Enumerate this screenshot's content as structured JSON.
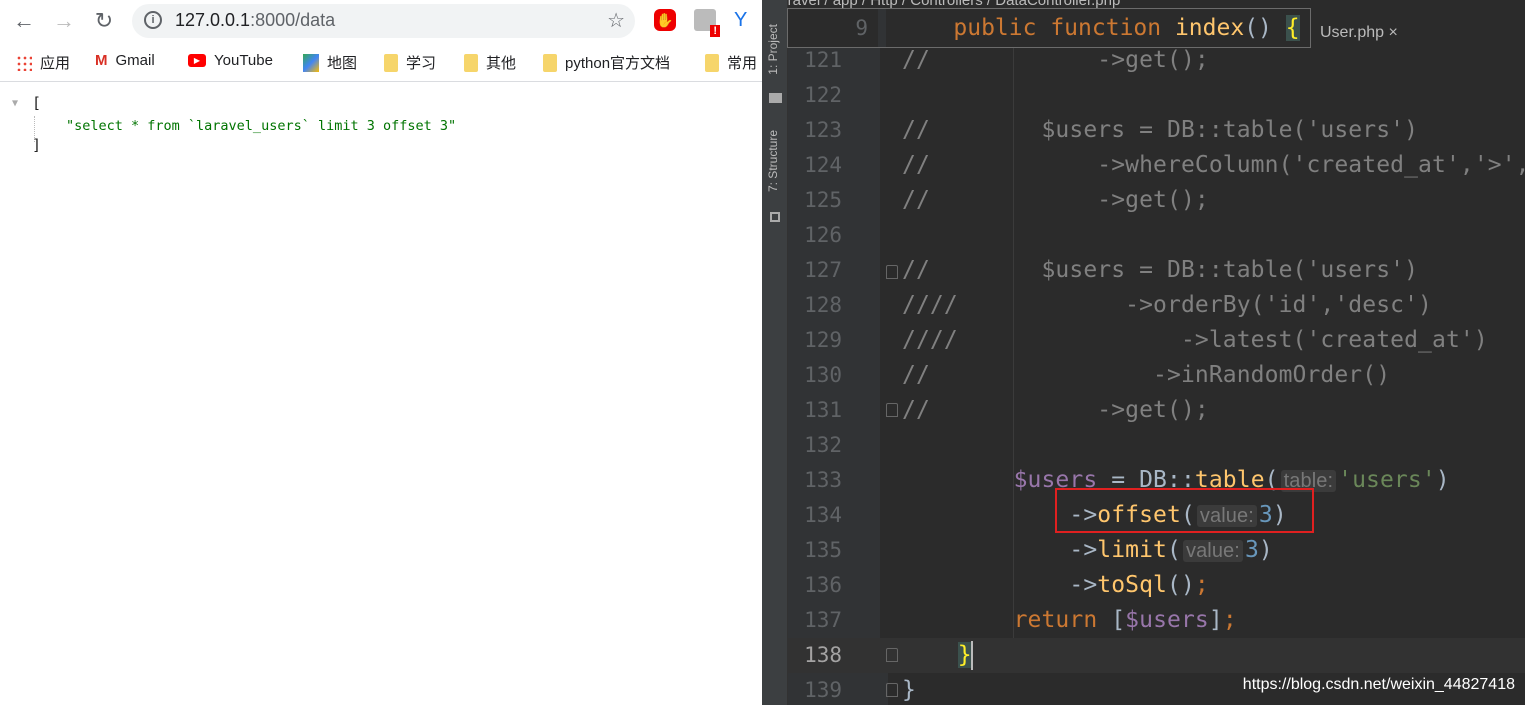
{
  "browser": {
    "url_host": "127.0.0.1",
    "url_rest": ":8000/data",
    "bookmarks": [
      {
        "label": "应用",
        "icon": "apps-grid-icon"
      },
      {
        "label": "Gmail",
        "icon": "gmail-icon"
      },
      {
        "label": "YouTube",
        "icon": "youtube-icon"
      },
      {
        "label": "地图",
        "icon": "maps-icon"
      },
      {
        "label": "学习",
        "icon": "folder-icon"
      },
      {
        "label": "其他",
        "icon": "folder-icon"
      },
      {
        "label": "python官方文档",
        "icon": "folder-icon"
      },
      {
        "label": "常用",
        "icon": "folder-icon"
      }
    ],
    "json_open": "[",
    "json_value": "\"select * from `laravel_users` limit 3 offset 3\"",
    "json_close": "]"
  },
  "ide": {
    "breadcrumb": "laravel / app / Http / Controllers / DataController.php",
    "tab_partial": "User.php ×",
    "tool_windows": [
      "1: Project",
      "7: Structure"
    ],
    "popup": {
      "line": "9",
      "tokens": [
        {
          "t": "    public ",
          "c": "kw"
        },
        {
          "t": "function ",
          "c": "kw"
        },
        {
          "t": "index",
          "c": "fn"
        },
        {
          "t": "() ",
          "c": "p"
        },
        {
          "t": "{",
          "c": "br"
        }
      ]
    },
    "current_line": "138",
    "lines": [
      {
        "n": "121",
        "tokens": [
          {
            "t": "//            ->get();",
            "c": "cm"
          }
        ]
      },
      {
        "n": "122",
        "tokens": []
      },
      {
        "n": "123",
        "tokens": [
          {
            "t": "//        $users = DB::table('users')",
            "c": "cm"
          }
        ]
      },
      {
        "n": "124",
        "tokens": [
          {
            "t": "//            ->whereColumn('created_at','>',",
            "c": "cm"
          }
        ]
      },
      {
        "n": "125",
        "tokens": [
          {
            "t": "//            ->get();",
            "c": "cm"
          }
        ]
      },
      {
        "n": "126",
        "tokens": []
      },
      {
        "n": "127",
        "tokens": [
          {
            "t": "//        $users = DB::table('users')",
            "c": "cm"
          }
        ]
      },
      {
        "n": "128",
        "tokens": [
          {
            "t": "////            ->orderBy('id','desc')",
            "c": "cm"
          }
        ]
      },
      {
        "n": "129",
        "tokens": [
          {
            "t": "////                ->latest('created_at')",
            "c": "cm"
          }
        ]
      },
      {
        "n": "130",
        "tokens": [
          {
            "t": "//                ->inRandomOrder()",
            "c": "cm"
          }
        ]
      },
      {
        "n": "131",
        "tokens": [
          {
            "t": "//            ->get();",
            "c": "cm"
          }
        ]
      },
      {
        "n": "132",
        "tokens": []
      },
      {
        "n": "133",
        "tokens": [
          {
            "t": "        ",
            "c": "p"
          },
          {
            "t": "$users",
            "c": "var"
          },
          {
            "t": " = DB::",
            "c": "p"
          },
          {
            "t": "table",
            "c": "fn"
          },
          {
            "t": "(",
            "c": "p"
          },
          {
            "t": "table:",
            "c": "hint"
          },
          {
            "t": "'users'",
            "c": "str"
          },
          {
            "t": ")",
            "c": "p"
          }
        ]
      },
      {
        "n": "134",
        "tokens": [
          {
            "t": "            ->",
            "c": "p"
          },
          {
            "t": "offset",
            "c": "fn"
          },
          {
            "t": "(",
            "c": "p"
          },
          {
            "t": "value:",
            "c": "hint"
          },
          {
            "t": "3",
            "c": "num"
          },
          {
            "t": ")",
            "c": "p"
          }
        ]
      },
      {
        "n": "135",
        "tokens": [
          {
            "t": "            ->",
            "c": "p"
          },
          {
            "t": "limit",
            "c": "fn"
          },
          {
            "t": "(",
            "c": "p"
          },
          {
            "t": "value:",
            "c": "hint"
          },
          {
            "t": "3",
            "c": "num"
          },
          {
            "t": ")",
            "c": "p"
          }
        ]
      },
      {
        "n": "136",
        "tokens": [
          {
            "t": "            ->",
            "c": "p"
          },
          {
            "t": "toSql",
            "c": "fn"
          },
          {
            "t": "()",
            "c": "p"
          },
          {
            "t": ";",
            "c": "kw"
          }
        ]
      },
      {
        "n": "137",
        "tokens": [
          {
            "t": "        ",
            "c": "p"
          },
          {
            "t": "return ",
            "c": "kw"
          },
          {
            "t": "[",
            "c": "p"
          },
          {
            "t": "$users",
            "c": "var"
          },
          {
            "t": "]",
            "c": "p"
          },
          {
            "t": ";",
            "c": "kw"
          }
        ]
      },
      {
        "n": "138",
        "tokens": [
          {
            "t": "    ",
            "c": "p"
          },
          {
            "t": "}",
            "c": "br"
          }
        ]
      },
      {
        "n": "139",
        "tokens": [
          {
            "t": "}",
            "c": "p"
          }
        ]
      }
    ]
  },
  "watermark": "https://blog.csdn.net/weixin_44827418",
  "colors": {
    "highlight_box": "#e02020",
    "comment": "#808080",
    "keyword": "#cc7832",
    "function": "#ffc66d",
    "variable": "#9876aa",
    "string": "#6a8759",
    "number": "#6897bb"
  }
}
